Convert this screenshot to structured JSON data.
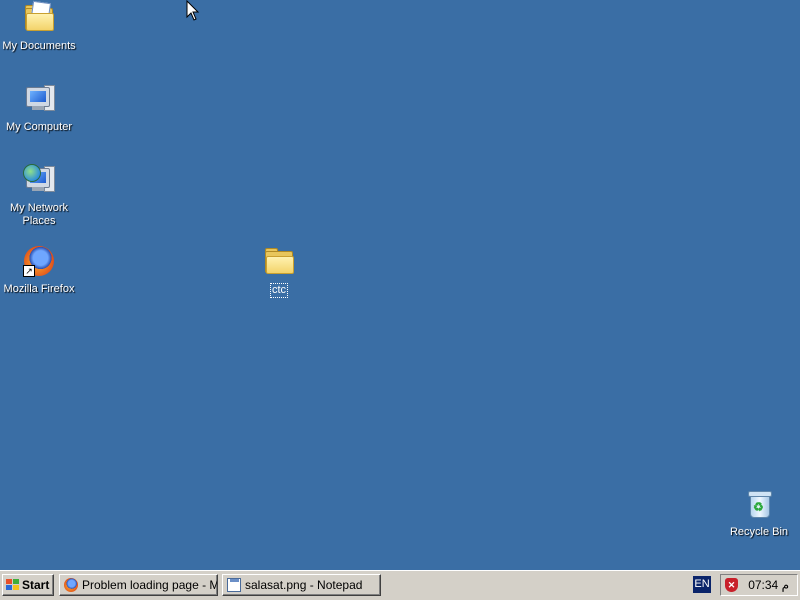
{
  "desktop": {
    "icons": [
      {
        "label": "My Documents",
        "icon": "my-documents-icon"
      },
      {
        "label": "My Computer",
        "icon": "my-computer-icon"
      },
      {
        "label": "My Network Places",
        "icon": "network-places-icon"
      },
      {
        "label": "Mozilla Firefox",
        "icon": "firefox-icon"
      },
      {
        "label": "ctc",
        "icon": "folder-icon"
      },
      {
        "label": "Recycle Bin",
        "icon": "recycle-bin-icon"
      }
    ],
    "background_color": "#3a6ea5"
  },
  "taskbar": {
    "start_label": "Start",
    "tasks": [
      {
        "label": "Problem loading page - M...",
        "icon": "firefox-icon"
      },
      {
        "label": "salasat.png - Notepad",
        "icon": "notepad-icon"
      }
    ],
    "language": "EN",
    "clock": "07:34 م",
    "tray_icon": "shield-icon"
  }
}
